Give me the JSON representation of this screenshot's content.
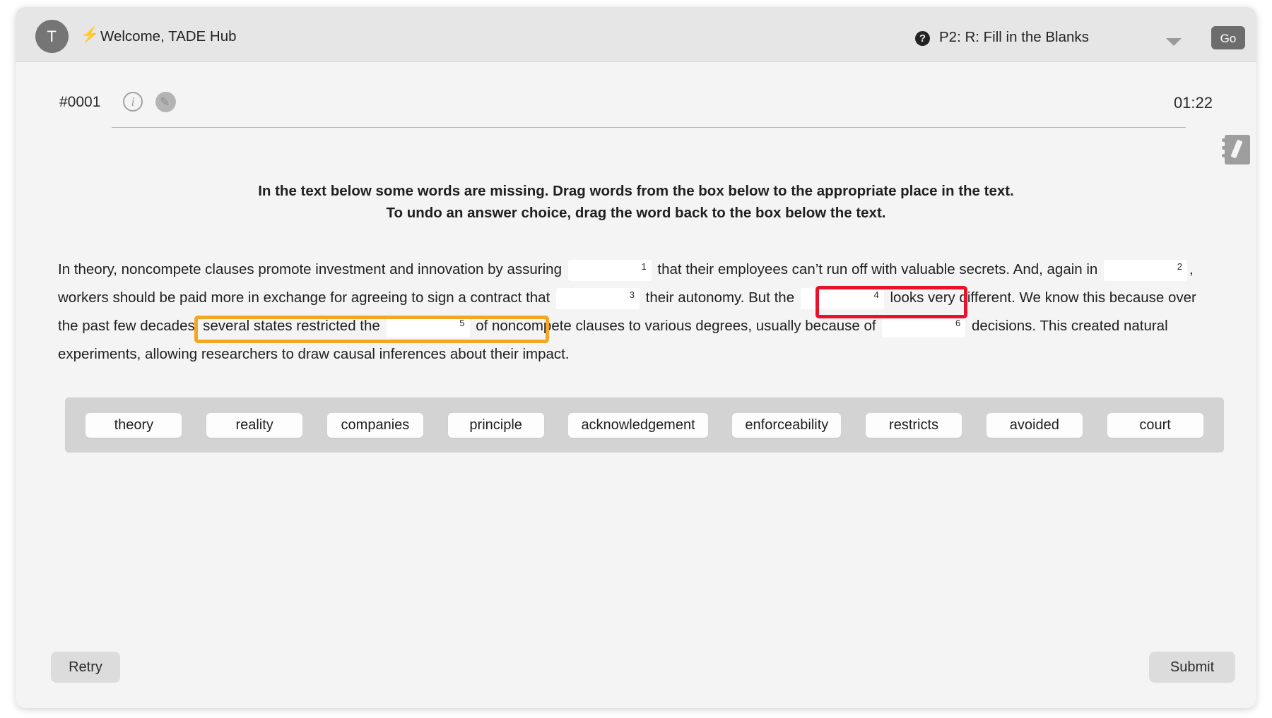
{
  "header": {
    "avatar_initial": "T",
    "bolt_icon": "bolt-icon",
    "welcome_text": "Welcome, TADE Hub",
    "help_icon": "?",
    "section_label": "P2: R: Fill in the Blanks",
    "dropdown_caret": "chevron-down-icon",
    "go_label": "Go"
  },
  "question_meta": {
    "question_id": "#0001",
    "info_icon": "i",
    "notes_icon": "✎",
    "timer": "01:22"
  },
  "instructions": {
    "line1": "In the text below some words are missing. Drag words from the box below to the appropriate place in the text.",
    "line2": "To undo an answer choice, drag the word back to the box below the text."
  },
  "passage": {
    "segments": [
      {
        "type": "text",
        "value": "In theory, noncompete clauses promote investment and innovation by assuring "
      },
      {
        "type": "blank",
        "number": "1"
      },
      {
        "type": "text",
        "value": " that their employees can’t run off with valuable secrets. And, again in "
      },
      {
        "type": "blank",
        "number": "2"
      },
      {
        "type": "text",
        "value": ", workers should be paid more in exchange for agreeing to sign a contract that "
      },
      {
        "type": "blank",
        "number": "3"
      },
      {
        "type": "text",
        "value": " their autonomy. But the "
      },
      {
        "type": "blank",
        "number": "4"
      },
      {
        "type": "text",
        "value": " looks very different. We know this because over the past few decades, several states restricted the "
      },
      {
        "type": "blank",
        "number": "5"
      },
      {
        "type": "text",
        "value": " of noncompete clauses to various degrees, usually because of "
      },
      {
        "type": "blank",
        "number": "6"
      },
      {
        "type": "text",
        "value": " decisions. This created natural experiments, allowing researchers to draw causal inferences about their impact."
      }
    ]
  },
  "word_bank": {
    "options": [
      "theory",
      "reality",
      "companies",
      "principle",
      "acknowledgement",
      "enforceability",
      "restricts",
      "avoided",
      "court"
    ]
  },
  "annotations": {
    "red_box_color": "#e8132b",
    "orange_box_color": "#f5a623"
  },
  "footer": {
    "retry_label": "Retry",
    "submit_label": "Submit"
  },
  "colors": {
    "header_bg": "#e6e6e6",
    "page_bg": "#f4f4f4",
    "word_bank_bg": "#d3d3d3",
    "button_bg": "#dcdcdc",
    "go_bg": "#6d6d6d"
  }
}
